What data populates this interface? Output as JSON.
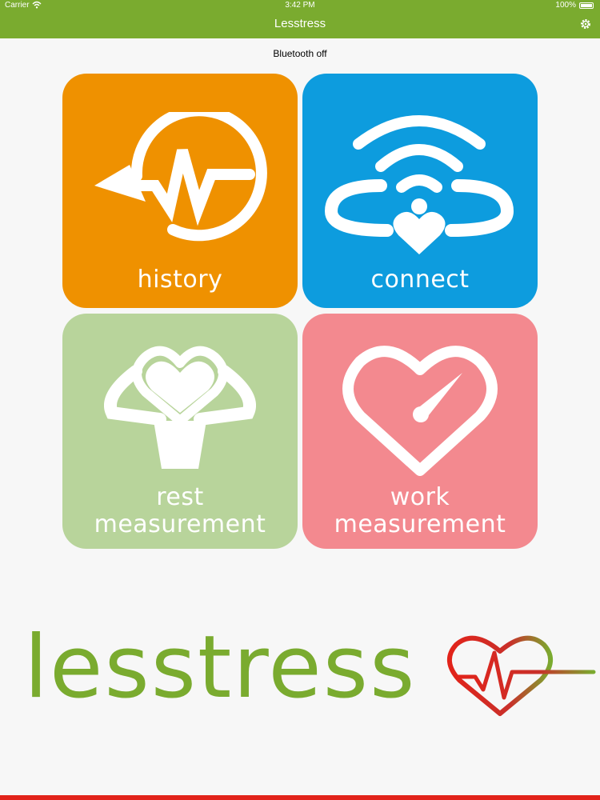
{
  "status_bar": {
    "carrier": "Carrier",
    "time": "3:42 PM",
    "battery": "100%"
  },
  "nav": {
    "title": "Lesstress"
  },
  "bluetooth_status": "Bluetooth off",
  "tiles": [
    {
      "id": "history",
      "line1": "history",
      "line2": "",
      "color": "#ef9100",
      "icon": "history-icon"
    },
    {
      "id": "connect",
      "line1": "connect",
      "line2": "",
      "color": "#0d9cde",
      "icon": "wireless-heart-icon"
    },
    {
      "id": "rest",
      "line1": "rest",
      "line2": "measurement",
      "color": "#b8d49b",
      "icon": "relaxing-person-heart-icon"
    },
    {
      "id": "work",
      "line1": "work",
      "line2": "measurement",
      "color": "#f3898f",
      "icon": "heart-gauge-icon"
    }
  ],
  "logo": {
    "text": "lesstress",
    "color": "#7aab2f",
    "accent": "#e2231a"
  },
  "colors": {
    "brand_green": "#7aab2f",
    "bottom_bar": "#e2231a"
  }
}
